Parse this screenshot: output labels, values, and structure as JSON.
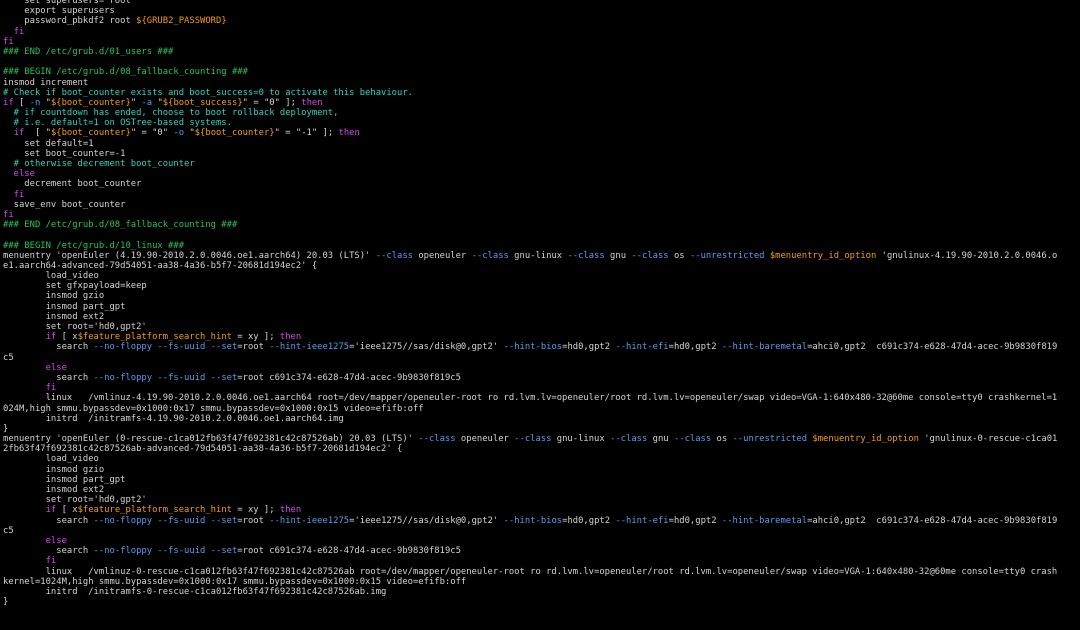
{
  "window": {
    "kind": "terminal",
    "background": "#000000"
  },
  "colors": {
    "w": "#d4d4d4",
    "g": "#22c55e",
    "c": "#2dd4bf",
    "m": "#c026d3",
    "p": "#d946ef",
    "y": "#f59e0b",
    "b": "#5b9cf0",
    "s": "#d4d4d4"
  },
  "lines": [
    [
      [
        "w",
        "    set superusers=\"root\""
      ]
    ],
    [
      [
        "w",
        "    export superusers"
      ]
    ],
    [
      [
        "w",
        "    password_pbkdf2 root "
      ],
      [
        "y",
        "${GRUB2_PASSWORD}"
      ]
    ],
    [
      [
        "p",
        "  fi"
      ]
    ],
    [
      [
        "p",
        "fi"
      ]
    ],
    [
      [
        "g",
        "### END /etc/grub.d/01_users ###"
      ]
    ],
    [
      [
        "w",
        ""
      ]
    ],
    [
      [
        "g",
        "### BEGIN /etc/grub.d/08_fallback_counting ###"
      ]
    ],
    [
      [
        "w",
        "insmod increment"
      ]
    ],
    [
      [
        "c",
        "# Check if boot_counter exists and boot_success=0 to activate this behaviour."
      ]
    ],
    [
      [
        "p",
        "if"
      ],
      [
        "w",
        " [ "
      ],
      [
        "b",
        "-n"
      ],
      [
        "w",
        " \""
      ],
      [
        "y",
        "${boot_counter}"
      ],
      [
        "w",
        "\" "
      ],
      [
        "b",
        "-a"
      ],
      [
        "w",
        " \""
      ],
      [
        "y",
        "${boot_success}"
      ],
      [
        "w",
        "\" = \"0\" ]; "
      ],
      [
        "p",
        "then"
      ]
    ],
    [
      [
        "c",
        "  # if countdown has ended, choose to boot rollback deployment,"
      ]
    ],
    [
      [
        "c",
        "  # i.e. default=1 on OSTree-based systems."
      ]
    ],
    [
      [
        "p",
        "  if"
      ],
      [
        "w",
        "  [ \""
      ],
      [
        "y",
        "${boot_counter}"
      ],
      [
        "w",
        "\" = \"0\" "
      ],
      [
        "b",
        "-o"
      ],
      [
        "w",
        " \""
      ],
      [
        "y",
        "${boot_counter}"
      ],
      [
        "w",
        "\" = \"-1\" ]; "
      ],
      [
        "p",
        "then"
      ]
    ],
    [
      [
        "w",
        "    set default=1"
      ]
    ],
    [
      [
        "w",
        "    set boot_counter=-1"
      ]
    ],
    [
      [
        "c",
        "  # otherwise decrement boot_counter"
      ]
    ],
    [
      [
        "p",
        "  else"
      ]
    ],
    [
      [
        "w",
        "    decrement boot_counter"
      ]
    ],
    [
      [
        "p",
        "  fi"
      ]
    ],
    [
      [
        "w",
        "  save_env boot_counter"
      ]
    ],
    [
      [
        "p",
        "fi"
      ]
    ],
    [
      [
        "g",
        "### END /etc/grub.d/08_fallback_counting ###"
      ]
    ],
    [
      [
        "w",
        ""
      ]
    ],
    [
      [
        "g",
        "### BEGIN /etc/grub.d/10_linux ###"
      ]
    ],
    [
      [
        "w",
        "menuentry 'openEuler (4.19.90-2010.2.0.0046.oe1.aarch64) 20.03 (LTS)' "
      ],
      [
        "b",
        "--class"
      ],
      [
        "w",
        " openeuler "
      ],
      [
        "b",
        "--class"
      ],
      [
        "w",
        " gnu-linux "
      ],
      [
        "b",
        "--class"
      ],
      [
        "w",
        " gnu "
      ],
      [
        "b",
        "--class"
      ],
      [
        "w",
        " os "
      ],
      [
        "b",
        "--unrestricted"
      ],
      [
        "w",
        " "
      ],
      [
        "y",
        "$menuentry_id_option"
      ],
      [
        "w",
        " 'gnulinux-4.19.90-2010.2.0.0046.o"
      ]
    ],
    [
      [
        "w",
        "e1.aarch64-advanced-79d54051-aa38-4a36-b5f7-20681d194ec2' {"
      ]
    ],
    [
      [
        "w",
        "        load_video"
      ]
    ],
    [
      [
        "w",
        "        set gfxpayload=keep"
      ]
    ],
    [
      [
        "w",
        "        insmod gzio"
      ]
    ],
    [
      [
        "w",
        "        insmod part_gpt"
      ]
    ],
    [
      [
        "w",
        "        insmod ext2"
      ]
    ],
    [
      [
        "w",
        "        set root='hd0,gpt2'"
      ]
    ],
    [
      [
        "p",
        "        if"
      ],
      [
        "w",
        " [ x"
      ],
      [
        "y",
        "$feature_platform_search_hint"
      ],
      [
        "w",
        " = xy ]; "
      ],
      [
        "p",
        "then"
      ]
    ],
    [
      [
        "w",
        "          search "
      ],
      [
        "b",
        "--no-floppy"
      ],
      [
        "w",
        " "
      ],
      [
        "b",
        "--fs-uuid"
      ],
      [
        "w",
        " "
      ],
      [
        "b",
        "--set"
      ],
      [
        "w",
        "=root "
      ],
      [
        "b",
        "--hint-ieee1275"
      ],
      [
        "w",
        "='ieee1275//sas/disk@0,gpt2' "
      ],
      [
        "b",
        "--hint-bios"
      ],
      [
        "w",
        "=hd0,gpt2 "
      ],
      [
        "b",
        "--hint-efi"
      ],
      [
        "w",
        "=hd0,gpt2 "
      ],
      [
        "b",
        "--hint-baremetal"
      ],
      [
        "w",
        "=ahci0,gpt2  c691c374-e628-47d4-acec-9b9830f819"
      ]
    ],
    [
      [
        "w",
        "c5"
      ]
    ],
    [
      [
        "p",
        "        else"
      ]
    ],
    [
      [
        "w",
        "          search "
      ],
      [
        "b",
        "--no-floppy"
      ],
      [
        "w",
        " "
      ],
      [
        "b",
        "--fs-uuid"
      ],
      [
        "w",
        " "
      ],
      [
        "b",
        "--set"
      ],
      [
        "w",
        "=root c691c374-e628-47d4-acec-9b9830f819c5"
      ]
    ],
    [
      [
        "p",
        "        fi"
      ]
    ],
    [
      [
        "w",
        "        linux   /vmlinuz-4.19.90-2010.2.0.0046.oe1.aarch64 root=/dev/mapper/openeuler-root ro rd.lvm.lv=openeuler/root rd.lvm.lv=openeuler/swap video=VGA-1:640x480-32@60me console=tty0 crashkernel=1"
      ]
    ],
    [
      [
        "w",
        "024M,high smmu.bypassdev=0x1000:0x17 smmu.bypassdev=0x1000:0x15 video=efifb:off"
      ]
    ],
    [
      [
        "w",
        "        initrd  /initramfs-4.19.90-2010.2.0.0046.oe1.aarch64.img"
      ]
    ],
    [
      [
        "w",
        "}"
      ]
    ],
    [
      [
        "w",
        "menuentry 'openEuler (0-rescue-c1ca012fb63f47f692381c42c87526ab) 20.03 (LTS)' "
      ],
      [
        "b",
        "--class"
      ],
      [
        "w",
        " openeuler "
      ],
      [
        "b",
        "--class"
      ],
      [
        "w",
        " gnu-linux "
      ],
      [
        "b",
        "--class"
      ],
      [
        "w",
        " gnu "
      ],
      [
        "b",
        "--class"
      ],
      [
        "w",
        " os "
      ],
      [
        "b",
        "--unrestricted"
      ],
      [
        "w",
        " "
      ],
      [
        "y",
        "$menuentry_id_option"
      ],
      [
        "w",
        " 'gnulinux-0-rescue-c1ca01"
      ]
    ],
    [
      [
        "w",
        "2fb63f47f692381c42c87526ab-advanced-79d54051-aa38-4a36-b5f7-20681d194ec2' {"
      ]
    ],
    [
      [
        "w",
        "        load_video"
      ]
    ],
    [
      [
        "w",
        "        insmod gzio"
      ]
    ],
    [
      [
        "w",
        "        insmod part_gpt"
      ]
    ],
    [
      [
        "w",
        "        insmod ext2"
      ]
    ],
    [
      [
        "w",
        "        set root='hd0,gpt2'"
      ]
    ],
    [
      [
        "p",
        "        if"
      ],
      [
        "w",
        " [ x"
      ],
      [
        "y",
        "$feature_platform_search_hint"
      ],
      [
        "w",
        " = xy ]; "
      ],
      [
        "p",
        "then"
      ]
    ],
    [
      [
        "w",
        "          search "
      ],
      [
        "b",
        "--no-floppy"
      ],
      [
        "w",
        " "
      ],
      [
        "b",
        "--fs-uuid"
      ],
      [
        "w",
        " "
      ],
      [
        "b",
        "--set"
      ],
      [
        "w",
        "=root "
      ],
      [
        "b",
        "--hint-ieee1275"
      ],
      [
        "w",
        "='ieee1275//sas/disk@0,gpt2' "
      ],
      [
        "b",
        "--hint-bios"
      ],
      [
        "w",
        "=hd0,gpt2 "
      ],
      [
        "b",
        "--hint-efi"
      ],
      [
        "w",
        "=hd0,gpt2 "
      ],
      [
        "b",
        "--hint-baremetal"
      ],
      [
        "w",
        "=ahci0,gpt2  c691c374-e628-47d4-acec-9b9830f819"
      ]
    ],
    [
      [
        "w",
        "c5"
      ]
    ],
    [
      [
        "p",
        "        else"
      ]
    ],
    [
      [
        "w",
        "          search "
      ],
      [
        "b",
        "--no-floppy"
      ],
      [
        "w",
        " "
      ],
      [
        "b",
        "--fs-uuid"
      ],
      [
        "w",
        " "
      ],
      [
        "b",
        "--set"
      ],
      [
        "w",
        "=root c691c374-e628-47d4-acec-9b9830f819c5"
      ]
    ],
    [
      [
        "p",
        "        fi"
      ]
    ],
    [
      [
        "w",
        "        linux   /vmlinuz-0-rescue-c1ca012fb63f47f692381c42c87526ab root=/dev/mapper/openeuler-root ro rd.lvm.lv=openeuler/root rd.lvm.lv=openeuler/swap video=VGA-1:640x480-32@60me console=tty0 crash"
      ]
    ],
    [
      [
        "w",
        "kernel=1024M,high smmu.bypassdev=0x1000:0x17 smmu.bypassdev=0x1000:0x15 video=efifb:off"
      ]
    ],
    [
      [
        "w",
        "        initrd  /initramfs-0-rescue-c1ca012fb63f47f692381c42c87526ab.img"
      ]
    ],
    [
      [
        "w",
        "}"
      ]
    ]
  ]
}
